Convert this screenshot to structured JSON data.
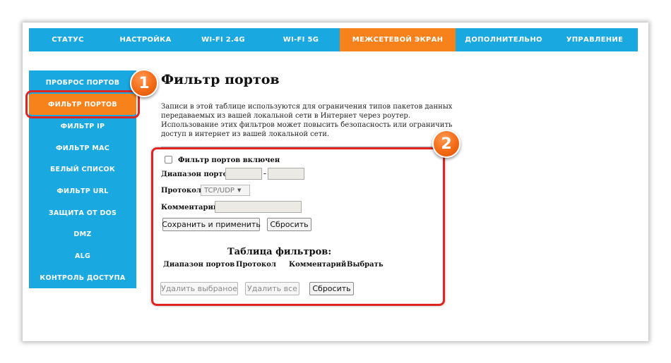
{
  "topnav": {
    "tabs": [
      {
        "label": "СТАТУС",
        "active": false
      },
      {
        "label": "НАСТРОЙКА",
        "active": false
      },
      {
        "label": "WI-FI 2.4G",
        "active": false
      },
      {
        "label": "WI-FI 5G",
        "active": false
      },
      {
        "label": "МЕЖСЕТЕВОЙ ЭКРАН",
        "active": true
      },
      {
        "label": "ДОПОЛНИТЕЛЬНО",
        "active": false
      },
      {
        "label": "УПРАВЛЕНИЕ",
        "active": false
      }
    ]
  },
  "sidebar": {
    "items": [
      {
        "label": "ПРОБРОС ПОРТОВ",
        "active": false
      },
      {
        "label": "ФИЛЬТР ПОРТОВ",
        "active": true
      },
      {
        "label": "ФИЛЬТР IP",
        "active": false
      },
      {
        "label": "ФИЛЬТР MAC",
        "active": false
      },
      {
        "label": "БЕЛЫЙ СПИСОК",
        "active": false
      },
      {
        "label": "ФИЛЬТР URL",
        "active": false
      },
      {
        "label": "ЗАЩИТА ОТ DOS",
        "active": false
      },
      {
        "label": "DMZ",
        "active": false
      },
      {
        "label": "ALG",
        "active": false
      },
      {
        "label": "КОНТРОЛЬ ДОСТУПА",
        "active": false
      }
    ]
  },
  "badges": {
    "one": "1",
    "two": "2"
  },
  "main": {
    "title": "Фильтр портов",
    "description": "Записи в этой таблице используются для ограничения типов пакетов данных передаваемых из вашей локальной сети в Интернет через роутер. Использование этих фильтров может повысить безопасность или ограничить доступ в интернет из вашей локальной сети."
  },
  "form": {
    "enable_label": "Фильтр портов включен",
    "enable_checked": false,
    "port_range_label": "Диапазон портов:",
    "range_separator": "-",
    "port_from_value": "",
    "port_to_value": "",
    "protocol_label": "Протокол:",
    "protocol_value": "TCP/UDP",
    "comment_label": "Комментарий:",
    "comment_value": "",
    "save_button": "Сохранить и применить",
    "reset_button": "Сбросить"
  },
  "filter_table": {
    "title": "Таблица фильтров:",
    "columns": [
      "Диапазон портов",
      "Протокол",
      "Комментарий",
      "Выбрать"
    ],
    "rows": []
  },
  "table_actions": {
    "delete_selected": "Удалить выбраное",
    "delete_all": "Удалить все",
    "reset": "Сбросить"
  },
  "colors": {
    "nav_blue": "#1aa8e0",
    "active_orange": "#f7821b",
    "highlight_red": "#e02424"
  }
}
